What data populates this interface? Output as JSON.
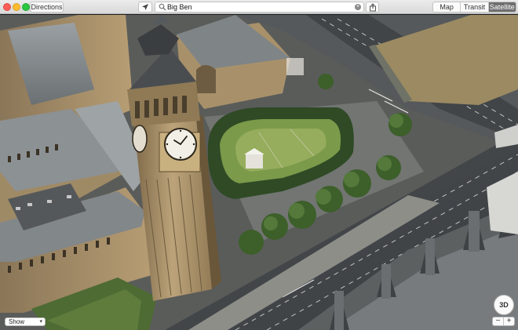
{
  "toolbar": {
    "directions_label": "Directions",
    "search_value": "Big Ben",
    "view_modes": [
      {
        "label": "Map",
        "active": false
      },
      {
        "label": "Transit",
        "active": false
      },
      {
        "label": "Satellite",
        "active": true
      }
    ]
  },
  "map": {
    "show_label": "Show",
    "three_d_label": "3D",
    "zoom_out_label": "−",
    "zoom_in_label": "+"
  },
  "icons": {
    "location": "location-arrow-icon",
    "search": "magnifier-icon",
    "clear": "clear-search-icon",
    "share": "share-icon"
  },
  "colors": {
    "segment_active": "#6e6e6e",
    "close": "#fc5f57",
    "minimize": "#fdbc2e",
    "maximize": "#2ac840"
  }
}
